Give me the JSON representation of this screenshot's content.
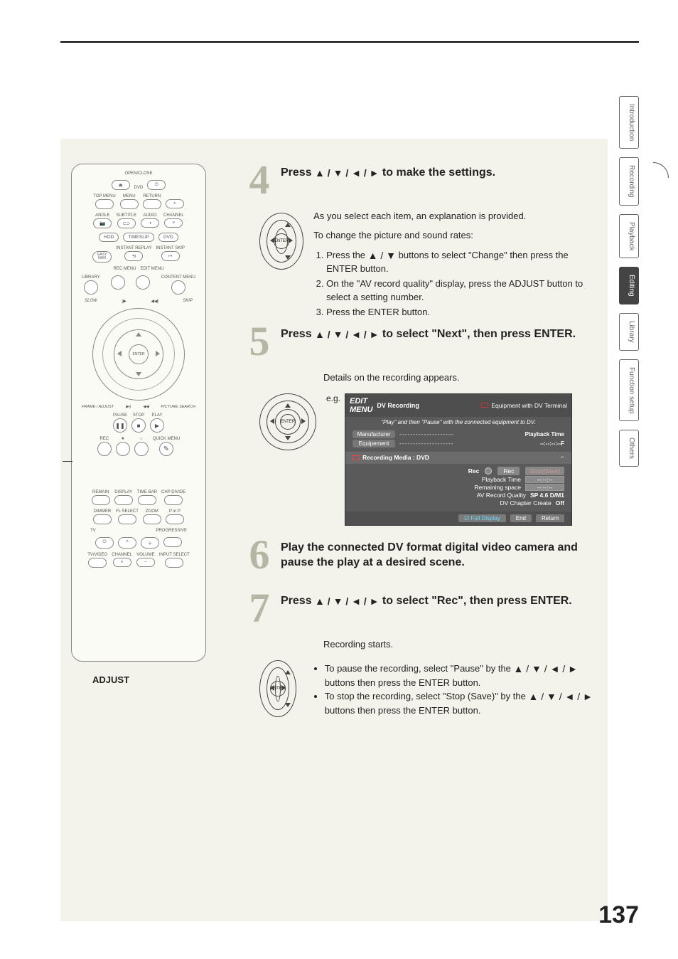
{
  "page_number": "137",
  "side_tabs": [
    "Introduction",
    "Recording",
    "Playback",
    "Editing",
    "Library",
    "Function setup",
    "Others"
  ],
  "active_tab_index": 3,
  "remote": {
    "open_close": "OPEN/CLOSE",
    "dvd": "DVD",
    "top_menu": "TOP MENU",
    "menu": "MENU",
    "return": "RETURN",
    "angle": "ANGLE",
    "subtitle": "SUBTITLE",
    "audio": "AUDIO",
    "channel": "CHANNEL",
    "hdd": "HDD",
    "timeslip": "TIMESLIP",
    "dvd2": "DVD",
    "instant_replay": "INSTANT REPLAY",
    "instant_skip": "INSTANT SKIP",
    "easy_navi": "EASY\nNAVI",
    "rec_menu": "REC MENU",
    "edit_menu": "EDIT MENU",
    "library": "LIBRARY",
    "content_menu": "CONTENT MENU",
    "enter": "ENTER",
    "slow": "SLOW",
    "skip": "SKIP",
    "frame_adjust": "FRAME / ADJUST",
    "picture_search": "PICTURE SEARCH",
    "pause": "PAUSE",
    "stop": "STOP",
    "play": "PLAY",
    "rec": "REC",
    "star": "★",
    "circ": "○",
    "quick_menu": "QUICK MENU",
    "remain": "REMAIN",
    "display": "DISPLAY",
    "time_bar": "TIME BAR",
    "chp_divide": "CHP DIVIDE",
    "dimmer": "DIMMER",
    "fl_select": "FL SELECT",
    "zoom": "ZOOM",
    "pinp": "P in P",
    "tv": "TV",
    "progressive": "PROGRESSIVE",
    "tvvideo": "TV/VIDEO",
    "channel2": "CHANNEL",
    "volume": "VOLUME",
    "input_select": "INPUT SELECT",
    "adjust_label": "ADJUST"
  },
  "steps": {
    "s4": {
      "num": "4",
      "title_pre": "Press ",
      "title_post": " to make the settings.",
      "p1": "As you select each item, an explanation is provided.",
      "p2": "To change the picture and sound rates:",
      "li1_a": "Press the ",
      "li1_b": " buttons to select \"Change\" then press the ENTER button.",
      "li2": "On the \"AV record quality\" display, press the ADJUST button to select a setting number.",
      "li3": "Press the ENTER button."
    },
    "s5": {
      "num": "5",
      "title_pre": "Press ",
      "title_mid": " to select \"Next\", then press ENTER.",
      "p1": "Details on the recording appears.",
      "eg": "e.g."
    },
    "s6": {
      "num": "6",
      "title": "Play the connected DV format digital video camera and pause the play at a desired scene."
    },
    "s7": {
      "num": "7",
      "title_pre": "Press ",
      "title_mid": " to select \"Rec\", then press ENTER.",
      "p1": "Recording starts.",
      "b1_a": "To pause the recording, select \"Pause\" by the ",
      "b1_b": " buttons then press the ENTER button.",
      "b2_a": "To stop the recording, select \"Stop (Save)\" by the ",
      "b2_b": " buttons then press the ENTER button."
    }
  },
  "osd": {
    "edit_menu": "EDIT\nMENU",
    "title": "DV Recording",
    "equip": "Equipment with DV Terminal",
    "instruction": "\"Play\" and then \"Pause\" with the connected equipment to DV.",
    "manufacturer": "Manufacturer",
    "equipment": "Equipement",
    "playback_time_lbl": "Playback Time",
    "playback_time_val": "--:--:--:--F",
    "recording_media": "Recording Media : DVD",
    "rec": "Rec",
    "rec_btn": "Rec",
    "stop_btn": "Stop(Save)",
    "pb_time": "Playback Time",
    "pb_time_val": "--:--:--",
    "remaining": "Remaining space",
    "remaining_val": "--:--:--",
    "avq": "AV Record Quality",
    "avq_val": "SP 4.6   D/M1",
    "dvchap": "DV Chapter Create",
    "dvchap_val": "Off",
    "full": "Full Display",
    "end": "End",
    "return": "Return"
  },
  "arrows": {
    "udlr": "▲ / ▼ / ◄ / ►",
    "ud": "▲ / ▼"
  },
  "enter_label": "ENTER"
}
